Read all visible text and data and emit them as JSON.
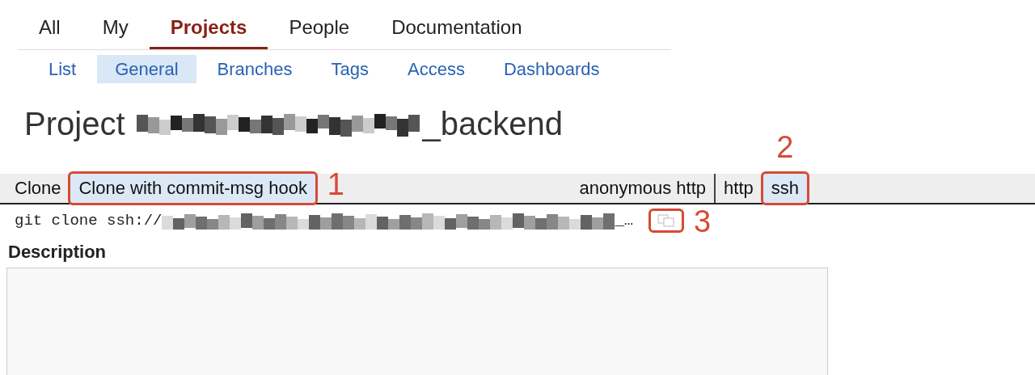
{
  "main_tabs": [
    {
      "label": "All",
      "selected": false
    },
    {
      "label": "My",
      "selected": false
    },
    {
      "label": "Projects",
      "selected": true
    },
    {
      "label": "People",
      "selected": false
    },
    {
      "label": "Documentation",
      "selected": false
    }
  ],
  "sub_tabs": [
    {
      "label": "List",
      "selected": false
    },
    {
      "label": "General",
      "selected": true
    },
    {
      "label": "Branches",
      "selected": false
    },
    {
      "label": "Tags",
      "selected": false
    },
    {
      "label": "Access",
      "selected": false
    },
    {
      "label": "Dashboards",
      "selected": false
    }
  ],
  "title": {
    "prefix": "Project",
    "suffix": "_backend"
  },
  "clone_bar": {
    "groups": [
      [
        {
          "label": "Clone",
          "selected": false
        },
        {
          "label": "Clone with commit-msg hook",
          "selected": true,
          "annotation": "1",
          "kind": "right"
        }
      ],
      [
        {
          "label": "anonymous http",
          "selected": false
        },
        {
          "label": "http",
          "selected": false
        },
        {
          "label": "ssh",
          "selected": true,
          "annotation": "2",
          "kind": "above"
        }
      ]
    ]
  },
  "clone_command": {
    "prefix": "git clone ssh://",
    "suffix": "_…",
    "copy_annotation": "3"
  },
  "description": {
    "label": "Description"
  }
}
